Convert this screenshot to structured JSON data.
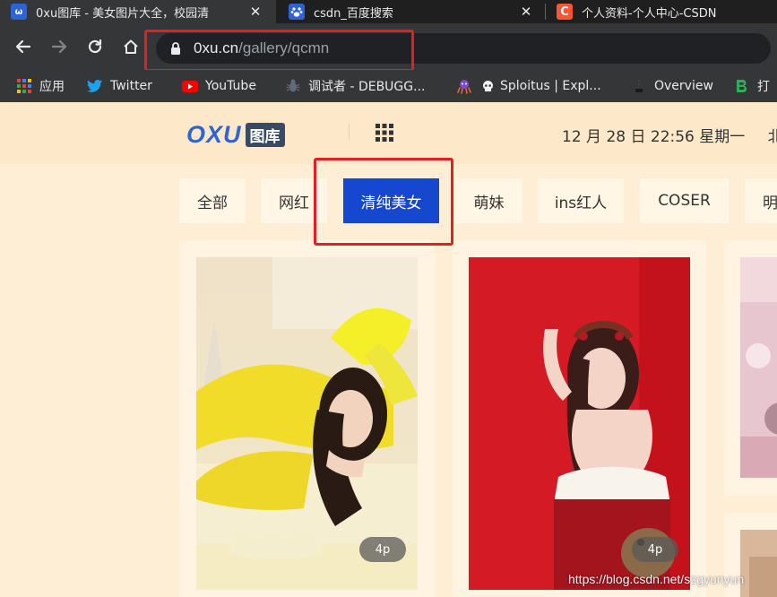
{
  "browser": {
    "tabs": [
      {
        "title": "0xu图库 - 美女图片大全，校园清",
        "close": "✕",
        "favicon": "oxu-favicon-icon",
        "active": true
      },
      {
        "title": "csdn_百度搜索",
        "close": "✕",
        "favicon": "baidu-paw-icon",
        "active": false
      },
      {
        "title": "个人资料-个人中心-CSDN",
        "close": "",
        "favicon": "csdn-c-icon",
        "active": false
      }
    ],
    "address_bar": {
      "host": "0xu.cn",
      "path": "/gallery/qcmn"
    },
    "bookmarks": [
      {
        "label": "应用",
        "icon": "apps-grid-icon"
      },
      {
        "label": "Twitter",
        "icon": "twitter-bird-icon"
      },
      {
        "label": "YouTube",
        "icon": "youtube-play-icon"
      },
      {
        "label": "调试者 - DEBUGG...",
        "icon": "bug-icon"
      },
      {
        "label": "Sploitus | Expl...",
        "icon": "skull-icon"
      },
      {
        "label": "Overview",
        "icon": "overview-icon"
      },
      {
        "label": "打",
        "icon": "b-logo-icon"
      }
    ],
    "annotation_color": "#e12025"
  },
  "site": {
    "logo_text": "OXU",
    "logo_badge": "图库",
    "datetime": "12 月 28 日 22:56 星期一",
    "location_fragment": "北",
    "accent": "#1547cf",
    "categories": [
      {
        "label": "全部",
        "active": false
      },
      {
        "label": "网红",
        "active": false
      },
      {
        "label": "清纯美女",
        "active": true
      },
      {
        "label": "萌妹",
        "active": false
      },
      {
        "label": "ins红人",
        "active": false
      },
      {
        "label": "COSER",
        "active": false
      },
      {
        "label": "明",
        "active": false
      }
    ],
    "gallery": [
      {
        "badge": "4p"
      },
      {
        "badge": "4p"
      }
    ]
  },
  "watermark": "https://blog.csdn.net/szgyunyun"
}
